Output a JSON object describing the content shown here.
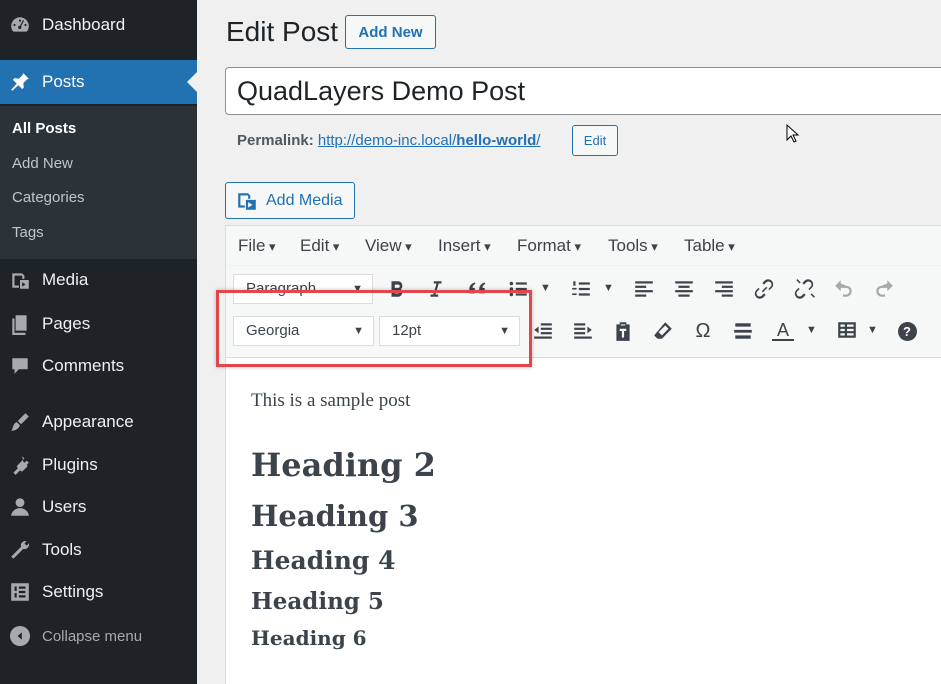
{
  "sidebar": {
    "items": [
      {
        "label": "Dashboard",
        "icon": "dashboard-icon"
      },
      {
        "label": "Posts",
        "icon": "pin-icon"
      },
      {
        "label": "Media",
        "icon": "media-icon"
      },
      {
        "label": "Pages",
        "icon": "pages-icon"
      },
      {
        "label": "Comments",
        "icon": "comments-icon"
      },
      {
        "label": "Appearance",
        "icon": "brush-icon"
      },
      {
        "label": "Plugins",
        "icon": "plugin-icon"
      },
      {
        "label": "Users",
        "icon": "user-icon"
      },
      {
        "label": "Tools",
        "icon": "wrench-icon"
      },
      {
        "label": "Settings",
        "icon": "settings-icon"
      }
    ],
    "submenu": [
      "All Posts",
      "Add New",
      "Categories",
      "Tags"
    ],
    "collapse_label": "Collapse menu"
  },
  "header": {
    "title": "Edit Post",
    "add_new_label": "Add New"
  },
  "post": {
    "title_value": "QuadLayers Demo Post",
    "permalink_label": "Permalink:",
    "permalink_base": "http://demo-inc.local/",
    "permalink_slug": "hello-world",
    "permalink_trail": "/",
    "edit_slug_label": "Edit",
    "add_media_label": "Add Media"
  },
  "editor": {
    "menubar": [
      "File",
      "Edit",
      "View",
      "Insert",
      "Format",
      "Tools",
      "Table"
    ],
    "format_select": "Paragraph",
    "font_family": "Georgia",
    "font_size": "12pt",
    "omega_glyph": "Ω",
    "text_color_glyph": "A",
    "help_glyph": "?"
  },
  "content": {
    "paragraph": "This is a sample post",
    "headings": [
      "Heading 2",
      "Heading 3",
      "Heading 4",
      "Heading 5",
      "Heading 6"
    ]
  },
  "colors": {
    "sidebar_bg": "#1d2327",
    "accent": "#2271b1",
    "highlight": "#e0474c"
  }
}
